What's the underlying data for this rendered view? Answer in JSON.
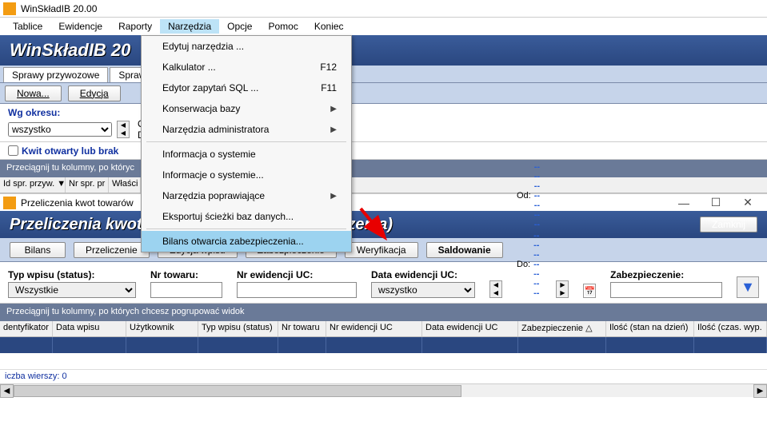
{
  "app": {
    "title": "WinSkładIB 20.00",
    "banner": "WinSkładIB 20"
  },
  "menubar": [
    "Tablice",
    "Ewidencje",
    "Raporty",
    "Narzędzia",
    "Opcje",
    "Pomoc",
    "Koniec"
  ],
  "menubar_active_index": 3,
  "dropdown": {
    "items": [
      {
        "label": "Edytuj narzędzia ...",
        "shortcut": "",
        "arrow": false
      },
      {
        "label": "Kalkulator ...",
        "shortcut": "F12",
        "arrow": false
      },
      {
        "label": "Edytor zapytań SQL ...",
        "shortcut": "F11",
        "arrow": false
      },
      {
        "label": "Konserwacja bazy",
        "shortcut": "",
        "arrow": true
      },
      {
        "label": "Narzędzia administratora",
        "shortcut": "",
        "arrow": true
      },
      {
        "sep": true
      },
      {
        "label": "Informacja o systemie",
        "shortcut": "",
        "arrow": false
      },
      {
        "label": "Informacje o systemie...",
        "shortcut": "",
        "arrow": false
      },
      {
        "label": "Narzędzia poprawiające",
        "shortcut": "",
        "arrow": true
      },
      {
        "label": "Eksportuj ścieżki baz danych...",
        "shortcut": "",
        "arrow": false
      },
      {
        "sep": true
      },
      {
        "label": "Bilans otwarcia zabezpieczenia...",
        "shortcut": "",
        "arrow": false,
        "highlight": true
      }
    ]
  },
  "tabs": [
    "Sprawy przywozowe",
    "Sprawy"
  ],
  "toolbar": {
    "nowa": "Nowa...",
    "edycja": "Edycja"
  },
  "filter": {
    "wg_okresu": "Wg okresu:",
    "wszystko": "wszystko",
    "od": "Od",
    "do": "Do",
    "kwit": "Kwit otwarty lub brak"
  },
  "groupbar": "Przeciągnij tu kolumny, po któryc",
  "cols1": [
    "Id spr. przyw. ▼",
    "Nr spr. pr",
    "Właści"
  ],
  "win2": {
    "title": "Przeliczenia kwot towarów",
    "banner": "Przeliczenia kwot towarów (bilans zabezpieczenia)",
    "zamknij": "Zamknij"
  },
  "toolbar2": [
    "Bilans",
    "Przeliczenie",
    "Edycja wpisu",
    "Zabezpieczenie",
    "Weryfikacja",
    "Saldowanie"
  ],
  "toolbar2_bold_index": 5,
  "filter2": {
    "typ_lbl": "Typ wpisu (status):",
    "typ_val": "Wszystkie",
    "nrtow_lbl": "Nr towaru:",
    "nrew_lbl": "Nr ewidencji UC:",
    "data_lbl": "Data ewidencji UC:",
    "data_val": "wszystko",
    "od": "Od:",
    "do": "Do:",
    "dash": "--------------",
    "zab_lbl": "Zabezpieczenie:"
  },
  "groupbar2": "Przeciągnij tu kolumny, po których chcesz pogrupować widok",
  "cols2": [
    "dentyfikator",
    "Data wpisu",
    "Użytkownik",
    "Typ wpisu (status)",
    "Nr towaru",
    "Nr ewidencji UC",
    "Data ewidencji UC",
    "Zabezpieczenie △",
    "Ilość (stan na dzień)",
    "Ilość (czas. wyp."
  ],
  "status": "iczba wierszy: 0"
}
